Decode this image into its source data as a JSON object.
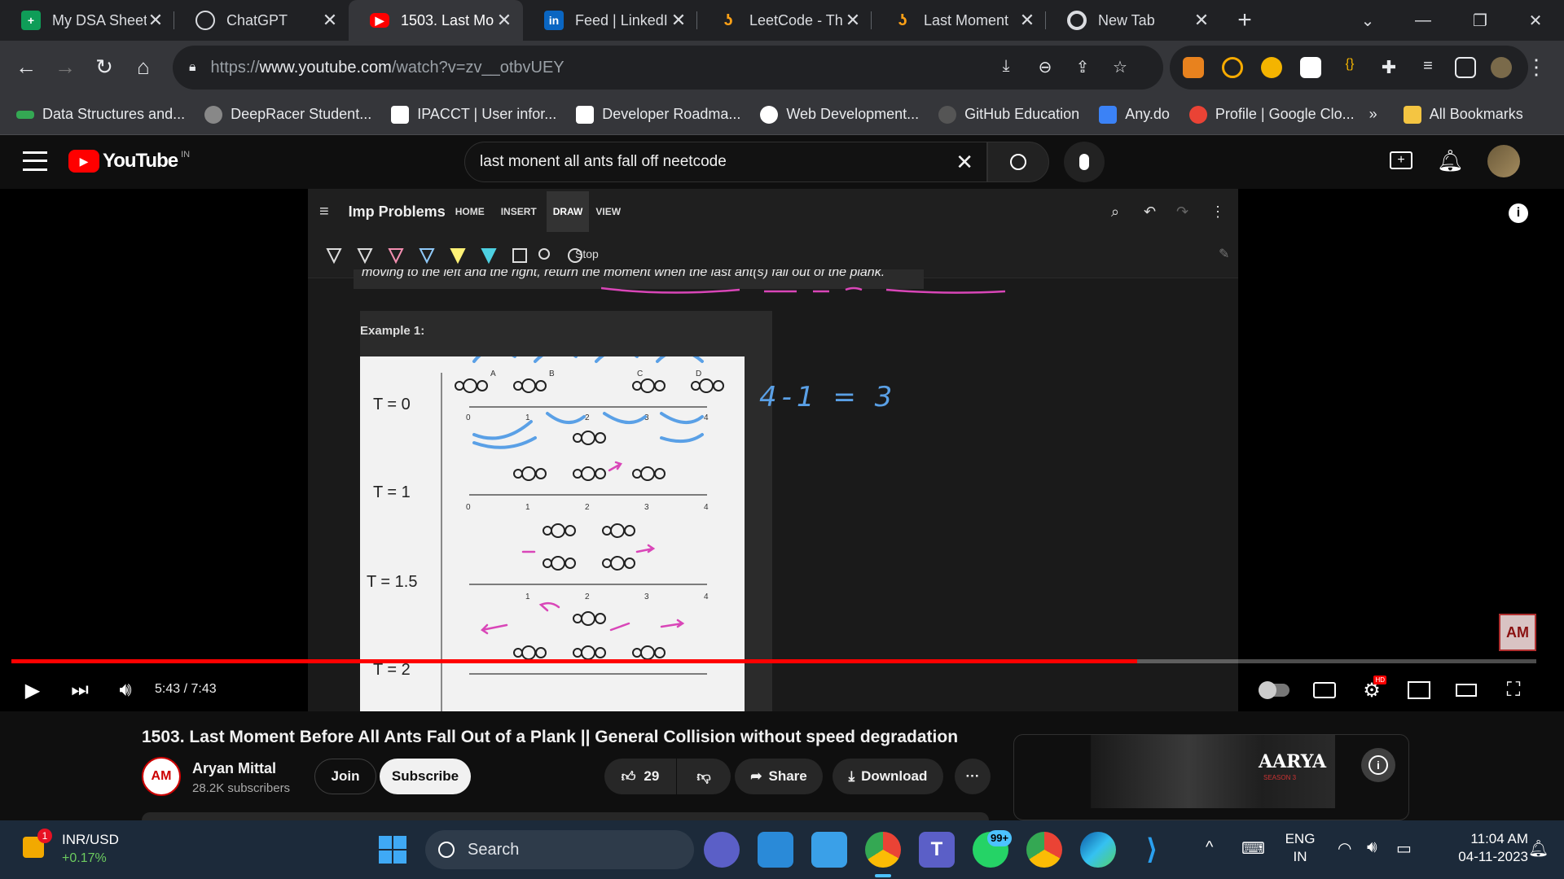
{
  "tabs": [
    {
      "title": "My DSA Sheet",
      "icon": "google-sheets-icon",
      "color": "#0f9d58"
    },
    {
      "title": "ChatGPT",
      "icon": "chatgpt-icon",
      "color": "#74aa9c"
    },
    {
      "title": "1503. Last Mo",
      "icon": "youtube-icon",
      "color": "#ff0000"
    },
    {
      "title": "Feed | LinkedI",
      "icon": "linkedin-icon",
      "color": "#0a66c2"
    },
    {
      "title": "LeetCode - Th",
      "icon": "leetcode-icon",
      "color": "#ffa116"
    },
    {
      "title": "Last Moment",
      "icon": "leetcode-icon",
      "color": "#ffa116"
    },
    {
      "title": "New Tab",
      "icon": "chrome-icon",
      "color": "#dadce0"
    }
  ],
  "address": {
    "prefix": "https://",
    "domain": "www.youtube.com",
    "path": "/watch?v=zv__otbvUEY"
  },
  "bookmarks": [
    {
      "label": "Data Structures and...",
      "color": "#34a853"
    },
    {
      "label": "DeepRacer Student...",
      "color": "#888888"
    },
    {
      "label": "IPACCT | User infor...",
      "color": "#ffffff"
    },
    {
      "label": "Developer Roadma...",
      "color": "#ffffff"
    },
    {
      "label": "Web Development...",
      "color": "#ffffff"
    },
    {
      "label": "GitHub Education",
      "color": "#555555"
    },
    {
      "label": "Any.do",
      "color": "#3b82f6"
    },
    {
      "label": "Profile | Google Clo...",
      "color": "#ea4335"
    }
  ],
  "bookmarks_more": "»",
  "bookmarks_all": "All Bookmarks",
  "youtube": {
    "logo_text": "YouTube",
    "country": "IN",
    "search_query": "last monent all ants fall off neetcode"
  },
  "onenote": {
    "notebook": "Imp Problems",
    "menu": [
      "HOME",
      "INSERT",
      "DRAW",
      "VIEW"
    ],
    "active_menu": "DRAW",
    "stop_label": "Stop",
    "problem_text": "moving to the left and the right, return the moment when the last ant(s) fall out of the plank.",
    "example_label": "Example 1:",
    "time_labels": [
      "T = 0",
      "T = 1",
      "T = 1.5",
      "T = 2"
    ],
    "ant_letters": [
      "A",
      "B",
      "C",
      "D"
    ],
    "tick_labels": [
      "0",
      "1",
      "2",
      "3",
      "4"
    ],
    "handwriting": "4-1 = 3"
  },
  "player": {
    "time_current": "5:43",
    "time_total": "7:43",
    "progress_fraction": 0.738,
    "channel_badge": "AM"
  },
  "video": {
    "title": "1503. Last Moment Before All Ants Fall Out of a Plank || General Collision without speed degradation",
    "channel": "Aryan Mittal",
    "subscribers": "28.2K subscribers",
    "join_label": "Join",
    "subscribe_label": "Subscribe",
    "likes": "29",
    "share_label": "Share",
    "download_label": "Download",
    "more_label": "···"
  },
  "ad": {
    "title": "AARYA",
    "subtitle": "SEASON 3"
  },
  "taskbar": {
    "stock_name": "INR/USD",
    "stock_change": "+0.17%",
    "stock_badge": "1",
    "search_placeholder": "Search",
    "whatsapp_badge": "99+",
    "lang_line1": "ENG",
    "lang_line2": "IN",
    "clock_time": "11:04 AM",
    "clock_date": "04-11-2023"
  }
}
